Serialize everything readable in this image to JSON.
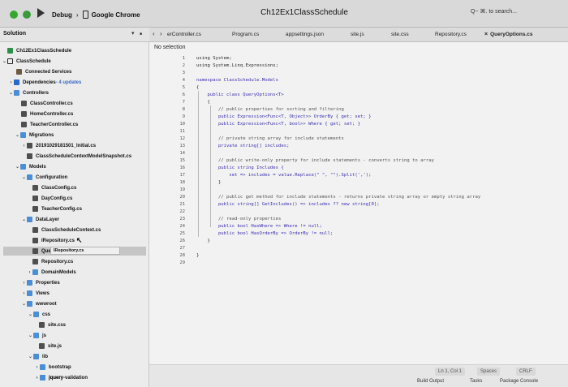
{
  "toolbar": {
    "scheme": "Debug",
    "separator": "›",
    "device": "Google Chrome",
    "window_title": "Ch12Ex1ClassSchedule",
    "search_placeholder": "Q~ ⌘. to search..."
  },
  "solution_panel": {
    "title": "Solution",
    "options_glyph": "▾",
    "close_glyph": "■"
  },
  "tabs": {
    "nav_glyph": "‹",
    "nav_forward_glyph": "›",
    "close_glyph": "×",
    "items": [
      {
        "label": "erController.cs"
      },
      {
        "label": "Program.cs"
      },
      {
        "label": "appsettings.json"
      },
      {
        "label": "site.js"
      },
      {
        "label": "site.css"
      },
      {
        "label": "Repository.cs"
      },
      {
        "label": "QueryOptions.cs"
      }
    ]
  },
  "tree": {
    "disclosure_open": "⌄",
    "disclosure_closed": "›",
    "cursor_glyph": "↖",
    "items": [
      {
        "label": "Ch12Ex1ClassSchedule"
      },
      {
        "label": "ClassSchedule"
      },
      {
        "label": "Connected Services"
      },
      {
        "label": "Dependencies",
        "sub": " - 4 updates"
      },
      {
        "label": "Controllers"
      },
      {
        "label": "ClassController.cs"
      },
      {
        "label": "HomeController.cs"
      },
      {
        "label": "TeacherController.cs"
      },
      {
        "label": "Migrations"
      },
      {
        "label": "20191029181501_Initial.cs"
      },
      {
        "label": "ClassScheduleContextModelSnapshot.cs"
      },
      {
        "label": "Models"
      },
      {
        "label": "Configuration"
      },
      {
        "label": "ClassConfig.cs"
      },
      {
        "label": "DayConfig.cs"
      },
      {
        "label": "TeacherConfig.cs"
      },
      {
        "label": "DataLayer"
      },
      {
        "label": "ClassScheduleContext.cs"
      },
      {
        "label": "IRepository.cs"
      },
      {
        "label": "QueryOption"
      },
      {
        "label": "Repository.cs"
      },
      {
        "label": "DomainModels"
      },
      {
        "label": "Properties"
      },
      {
        "label": "Views"
      },
      {
        "label": "wwwroot"
      },
      {
        "label": "css"
      },
      {
        "label": "site.css"
      },
      {
        "label": "js"
      },
      {
        "label": "site.js"
      },
      {
        "label": "lib"
      },
      {
        "label": "bootstrap"
      },
      {
        "label": "jquery"
      },
      {
        "label": "jquery-validation"
      }
    ],
    "tooltip": "IRepository.cs"
  },
  "editor": {
    "no_selection": "No selection",
    "line_numbers": [
      "1",
      "2",
      "3",
      "4",
      "5",
      "6",
      "7",
      "8",
      "9",
      "10",
      "11",
      "12",
      "13",
      "14",
      "15",
      "16",
      "17",
      "18",
      "19",
      "20",
      "21",
      "22",
      "23",
      "24",
      "25",
      "26",
      "27",
      "28",
      "29"
    ],
    "lines": [
      "using System;",
      "using System.Linq.Expressions;",
      "",
      "namespace ClassSchedule.Models",
      "{",
      "    public class QueryOptions<T>",
      "    {",
      "        // public properties for sorting and filtering",
      "        public Expression<Func<T, Object>> OrderBy { get; set; }",
      "        public Expression<Func<T, bool>> Where { get; set; }",
      "",
      "        // private string array for include statements",
      "        private string[] includes;",
      "",
      "        // public write-only property for include statements - converts string to array",
      "        public string Includes {",
      "            set => includes = value.Replace(\" \", \"\").Split(',');",
      "        }",
      "",
      "        // public get method for include statements - returns private string array or empty string array",
      "        public string[] GetIncludes() => includes ?? new string[0];",
      "",
      "        // read-only properties",
      "        public bool HasWhere => Where != null;",
      "        public bool HasOrderBy => OrderBy != null;",
      "    }",
      "",
      "}",
      ""
    ]
  },
  "status": {
    "position": "Ln 1, Col 1",
    "indent": "Spaces",
    "line_ending": "CRLF",
    "pads": [
      "Build Output",
      "Tasks",
      "Package Console"
    ]
  }
}
